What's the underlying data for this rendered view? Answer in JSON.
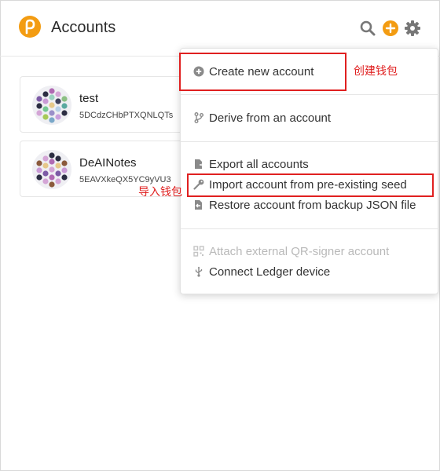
{
  "header": {
    "title": "Accounts"
  },
  "accounts": [
    {
      "name": "test",
      "address": "5DCdzCHbPTXQNLQTs"
    },
    {
      "name": "DeAINotes",
      "address": "5EAVXkeQX5YC9yVU3"
    }
  ],
  "menu": {
    "create": "Create new account",
    "derive": "Derive from an account",
    "export_all": "Export all accounts",
    "import_seed": "Import account from pre-existing seed",
    "restore_json": "Restore account from backup JSON file",
    "attach_qr": "Attach external QR-signer account",
    "connect_ledger": "Connect Ledger device"
  },
  "annotations": {
    "create_wallet": "创建钱包",
    "import_wallet": "导入钱包"
  },
  "colors": {
    "brand": "#f39c12",
    "annotation": "#e02020"
  },
  "icons": [
    "polkadot-logo-icon",
    "search-icon",
    "add-icon",
    "gear-icon",
    "plus-circle-icon",
    "branch-icon",
    "export-file-icon",
    "key-icon",
    "restore-file-icon",
    "qr-icon",
    "usb-icon"
  ]
}
